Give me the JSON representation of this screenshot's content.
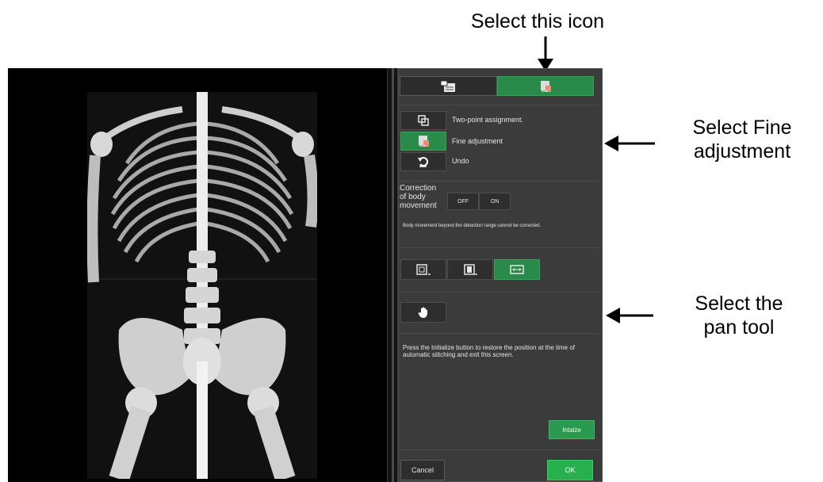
{
  "annotations": {
    "top": "Select this icon",
    "fine": [
      "Select Fine",
      "adjustment"
    ],
    "pan": [
      "Select the",
      "pan tool"
    ]
  },
  "panel": {
    "tools": [
      {
        "label": "Two-point assignment.",
        "icon": "two-point-icon",
        "active": false
      },
      {
        "label": "Fine adjustment",
        "icon": "fine-adjust-icon",
        "active": true
      },
      {
        "label": "Undo",
        "icon": "undo-icon",
        "active": false
      }
    ],
    "body_movement": {
      "label_lines": [
        "Correction",
        "of body",
        "movement"
      ],
      "off_label": "OFF",
      "on_label": "ON",
      "note": "Body movement beyond the detection range cannot be corrected."
    },
    "initialize_note": "Press the Initialize button to restore the position at the time of automatic stitching and exit this screen.",
    "initialize_label": "Intalze",
    "cancel_label": "Cancel",
    "ok_label": "OK"
  },
  "colors": {
    "accent_green": "#2a8a4a",
    "panel_bg": "#3b3b3b",
    "viewer_bg": "#000000"
  }
}
